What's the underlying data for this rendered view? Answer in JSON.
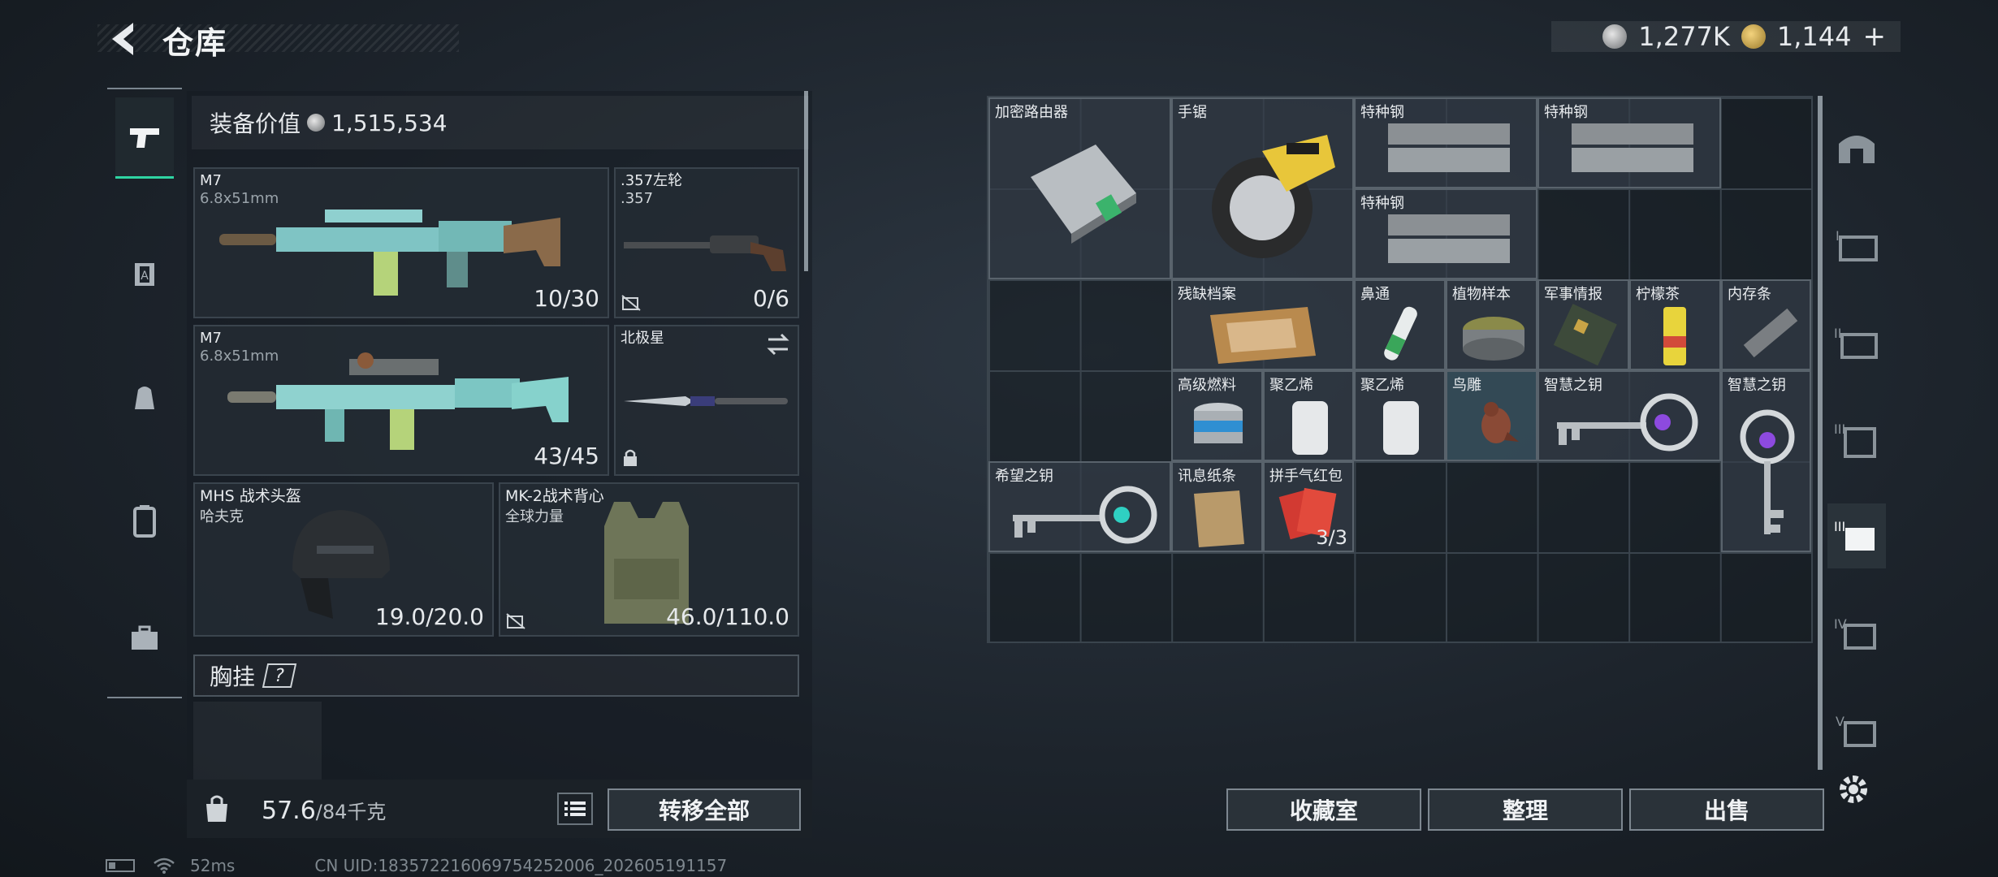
{
  "header": {
    "title": "仓库",
    "currency": [
      {
        "icon": "silver-coin-icon",
        "value": "1,277K"
      },
      {
        "icon": "gold-coin-icon",
        "value": "1,144"
      }
    ],
    "add_label": "+"
  },
  "loadout": {
    "value_label": "装备价值",
    "value": "1,515,534",
    "slots": [
      {
        "name": "M7",
        "sub": "6.8x51mm",
        "count": "10/30"
      },
      {
        "name": ".357左轮",
        "sub": ".357",
        "count": "0/6"
      },
      {
        "name": "M7",
        "sub": "6.8x51mm",
        "count": "43/45"
      },
      {
        "name": "北极星",
        "sub": "",
        "count": ""
      },
      {
        "name": "MHS 战术头盔",
        "sub": "哈夫克",
        "count": "19.0/20.0"
      },
      {
        "name": "MK-2战术背心",
        "sub": "全球力量",
        "count": "46.0/110.0"
      }
    ],
    "chest_label": "胸挂",
    "help_label": "?",
    "weight": "57.6",
    "weight_max": "/84千克",
    "transfer_all": "转移全部"
  },
  "stash": {
    "items": [
      {
        "name": "加密路由器",
        "count": ""
      },
      {
        "name": "手锯",
        "count": ""
      },
      {
        "name": "特种钢",
        "count": ""
      },
      {
        "name": "特种钢",
        "count": ""
      },
      {
        "name": "特种钢",
        "count": ""
      },
      {
        "name": "残缺档案",
        "count": ""
      },
      {
        "name": "鼻通",
        "count": ""
      },
      {
        "name": "植物样本",
        "count": ""
      },
      {
        "name": "军事情报",
        "count": ""
      },
      {
        "name": "柠檬茶",
        "count": ""
      },
      {
        "name": "内存条",
        "count": ""
      },
      {
        "name": "高级燃料",
        "count": ""
      },
      {
        "name": "聚乙烯",
        "count": ""
      },
      {
        "name": "聚乙烯",
        "count": ""
      },
      {
        "name": "鸟雕",
        "count": ""
      },
      {
        "name": "智慧之钥",
        "count": ""
      },
      {
        "name": "智慧之钥",
        "count": ""
      },
      {
        "name": "希望之钥",
        "count": ""
      },
      {
        "name": "讯息纸条",
        "count": ""
      },
      {
        "name": "拼手气红包",
        "count": "3/3"
      }
    ],
    "buttons": {
      "collection": "收藏室",
      "sort": "整理",
      "sell": "出售"
    }
  },
  "right_tabs": [
    "I",
    "II",
    "III",
    "IV",
    "V"
  ],
  "status": {
    "ping": "52ms",
    "uid": "CN UID:18357221606975425200​6_202605191157"
  }
}
